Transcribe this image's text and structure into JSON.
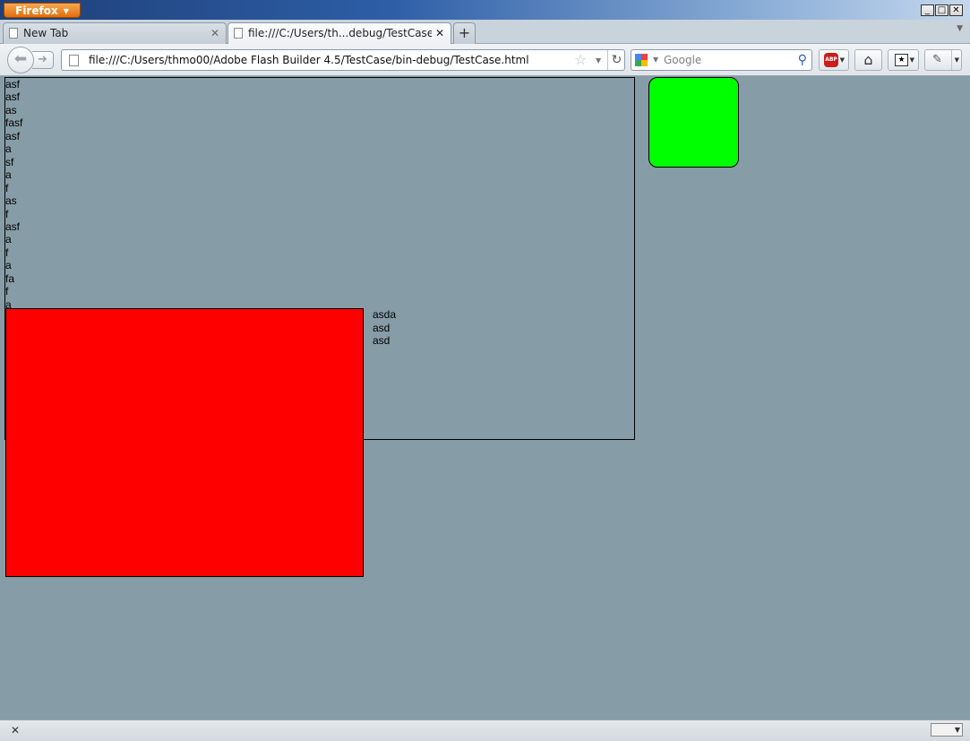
{
  "browser": {
    "menu_button": "Firefox",
    "window_controls": [
      "minimize",
      "maximize",
      "close"
    ]
  },
  "tabs": [
    {
      "label": "New Tab",
      "active": false
    },
    {
      "label": "file:///C:/Users/th...debug/TestCase.html",
      "active": true
    }
  ],
  "toolbar": {
    "url": "file:///C:/Users/thmo00/Adobe Flash Builder 4.5/TestCase/bin-debug/TestCase.html",
    "search_placeholder": "Google",
    "adblock_label": "ABP"
  },
  "content": {
    "background_color": "#869ca6",
    "panel_lines": [
      "asf",
      "asf",
      "as",
      "fasf",
      "asf",
      "a",
      "sf",
      "a",
      "f",
      "as",
      "f",
      "asf",
      "a",
      "f",
      "a",
      "fa",
      "f",
      "a"
    ],
    "side_lines": [
      "asda",
      "asd",
      "asd"
    ],
    "red_box_color": "#ff0000",
    "green_box_color": "#00ff00"
  },
  "icons": {
    "tab_close": "close-icon",
    "new_tab": "plus-icon",
    "back": "back-arrow-icon",
    "forward": "forward-arrow-icon",
    "bookmark_star": "star-icon",
    "reload": "reload-icon",
    "search": "magnifier-icon",
    "home": "home-icon"
  }
}
